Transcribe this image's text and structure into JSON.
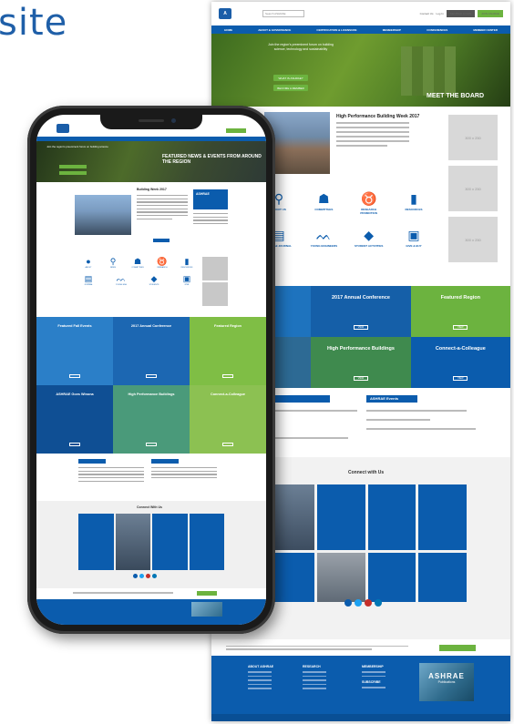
{
  "heading": "site",
  "desktop": {
    "search_placeholder": "Search ASHRAE",
    "top_links": [
      "Contact Us",
      "Log In"
    ],
    "login_button": "MEMBER LOGIN",
    "join_button": "JOIN ASHRAE",
    "nav_items": [
      "HOME",
      "ABOUT & GOVERNANCE",
      "CERTIFICATION & LICENSURE",
      "MEMBERSHIP",
      "CONFERENCES",
      "MEMBER CENTER"
    ],
    "hero_text": "Join the region's preeminent forum on building science, technology and sustainability",
    "hero_buttons": [
      "WHAT IS ASHRAE?",
      "BECOME A MEMBER"
    ],
    "hero_caption": "MEET THE BOARD",
    "event_title": "High Performance Building Week 2017",
    "ad_label": "300 x 250",
    "icon_labels": [
      "ABOUT US",
      "COMMITTEES",
      "RESEARCH PROMOTION",
      "RESOURCES",
      "ASHRAE JOURNAL",
      "YOUNG ENGINEERS",
      "STUDENT ACTIVITIES",
      "GIVE & BUY"
    ],
    "tiles": [
      "",
      "2017 Annual Conference",
      "Featured Region",
      "",
      "High Performance Buildings",
      "Connect-a-Colleague"
    ],
    "tile_button": "VIEW",
    "events_header": "ASHRAE Events",
    "connect_title": "Connect with Us",
    "footer_columns": [
      "ABOUT ASHRAE",
      "RESEARCH",
      "MEMBERSHIP",
      "SUBSCRIBE"
    ],
    "publication": {
      "logo": "ASHRAE",
      "subtitle": "Publications"
    }
  },
  "phone": {
    "hero_headline": "FEATURED NEWS & EVENTS FROM AROUND THE REGION",
    "hero_text": "Join the region's preeminent forum on building science",
    "event_title": "Building Week 2017",
    "side_ad_title": "ASHRAE",
    "icon_labels": [
      "ABOUT",
      "NEWS",
      "COMMITTEES",
      "RESEARCH",
      "RESOURCES",
      "JOURNAL",
      "YOUNG ENG",
      "STUDENTS",
      "GIVE"
    ],
    "tiles": [
      "Featured Fall Events",
      "2017 Annual Conference",
      "Featured Region",
      "ASHRAE Goes Winona",
      "High Performance Buildings",
      "Connect-a-Colleague"
    ],
    "connect_title": "Connect With Us"
  },
  "colors": {
    "brand_blue": "#0b5cad",
    "accent_green": "#6cb33f",
    "heading_blue": "#1f5fa8",
    "social": [
      "#0b5cad",
      "#1da1f2",
      "#c4302b",
      "#0077b5"
    ]
  }
}
